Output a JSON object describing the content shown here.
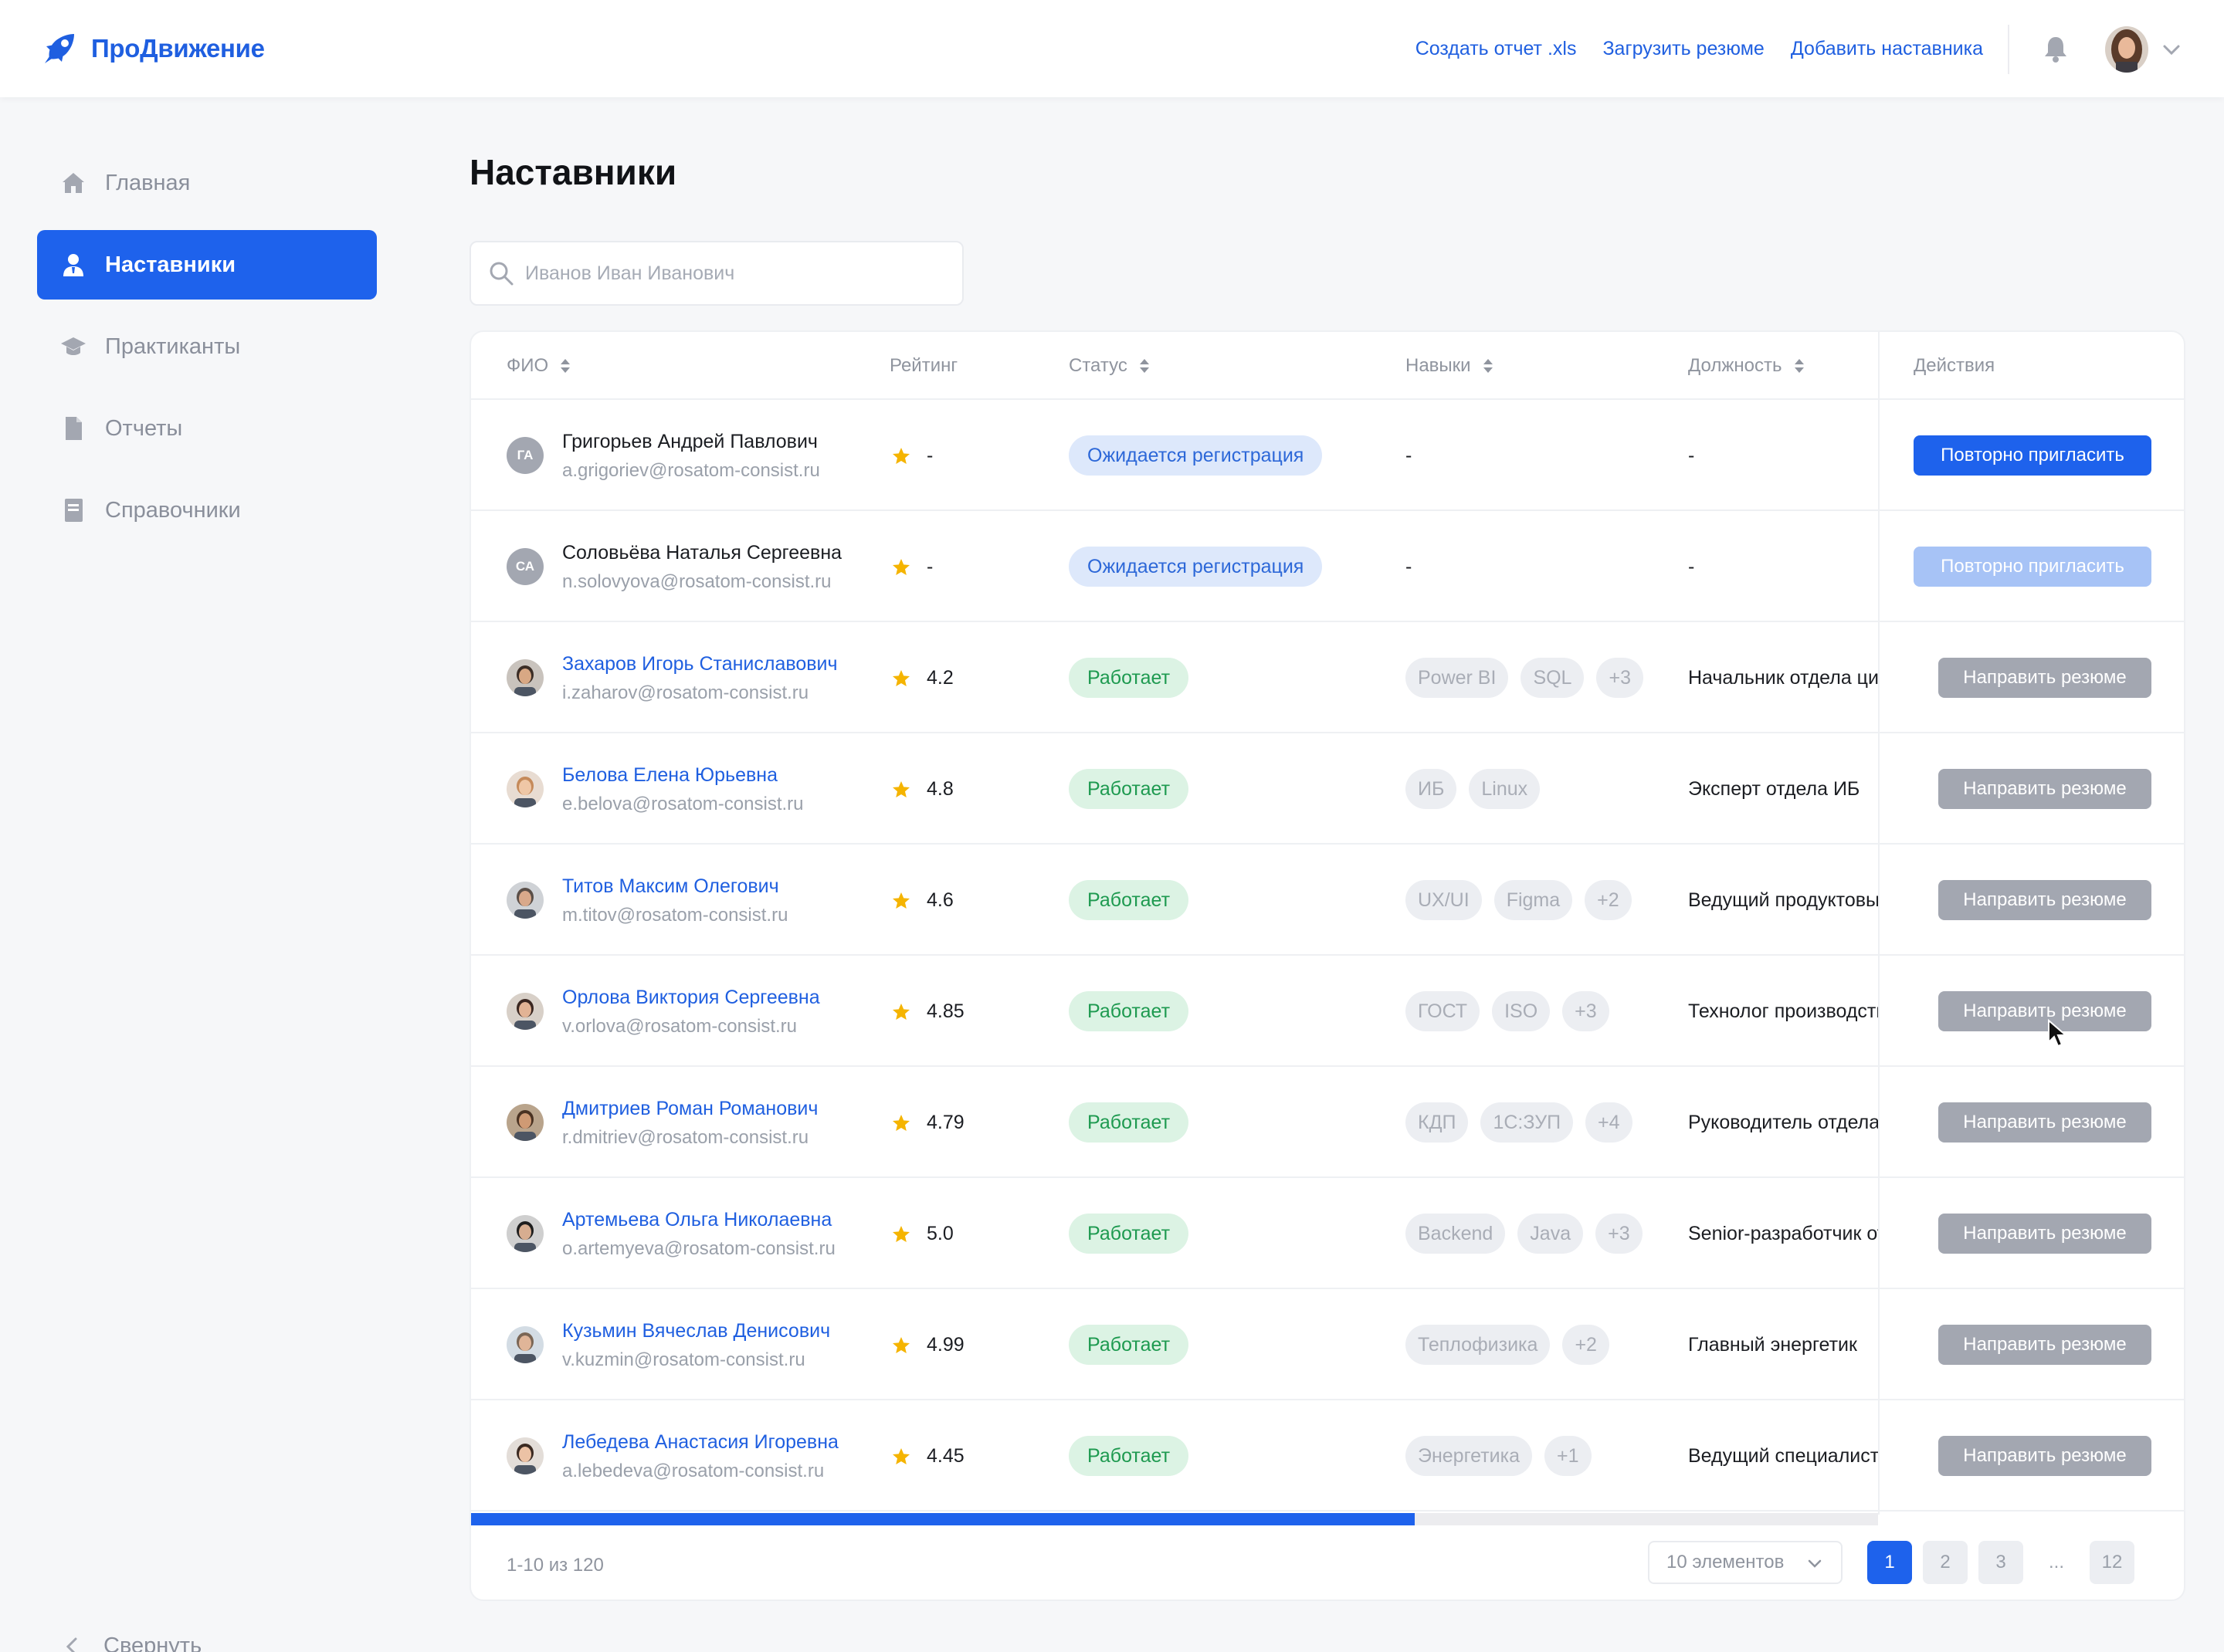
{
  "header": {
    "logo_text": "ПроДвижение",
    "links": [
      "Создать отчет .xls",
      "Загрузить резюме",
      "Добавить наставника"
    ]
  },
  "sidebar": {
    "items": [
      {
        "label": "Главная",
        "icon": "home-icon"
      },
      {
        "label": "Наставники",
        "icon": "mentor-icon",
        "active": true
      },
      {
        "label": "Практиканты",
        "icon": "graduation-cap-icon"
      },
      {
        "label": "Отчеты",
        "icon": "document-icon"
      },
      {
        "label": "Справочники",
        "icon": "book-icon"
      }
    ],
    "collapse_label": "Свернуть"
  },
  "page": {
    "title": "Наставники",
    "search_placeholder": "Иванов Иван Иванович"
  },
  "table": {
    "columns": {
      "fio": "ФИО",
      "rating": "Рейтинг",
      "status": "Статус",
      "skills": "Навыки",
      "position": "Должность",
      "actions": "Действия"
    },
    "rows": [
      {
        "name": "Григорьев Андрей Павлович",
        "email": "a.grigoriev@rosatom-consist.ru",
        "initials": "ГА",
        "rating": "-",
        "status": "Ожидается регистрация",
        "skills": [],
        "skills_dash": "-",
        "position": "-",
        "action": "Повторно пригласить",
        "action_state": "primary"
      },
      {
        "name": "Соловьёва Наталья Сергеевна",
        "email": "n.solovyova@rosatom-consist.ru",
        "initials": "СА",
        "rating": "-",
        "status": "Ожидается регистрация",
        "skills": [],
        "skills_dash": "-",
        "position": "-",
        "action": "Повторно пригласить",
        "action_state": "disabled"
      },
      {
        "name": "Захаров Игорь Станиславович",
        "email": "i.zaharov@rosatom-consist.ru",
        "rating": "4.2",
        "status": "Работает",
        "skills": [
          "Power BI",
          "SQL",
          "+3"
        ],
        "position": "Начальник отдела цифровизации",
        "action": "Направить резюме"
      },
      {
        "name": "Белова Елена Юрьевна",
        "email": "e.belova@rosatom-consist.ru",
        "rating": "4.8",
        "status": "Работает",
        "skills": [
          "ИБ",
          "Linux"
        ],
        "position": "Эксперт отдела ИБ",
        "action": "Направить резюме"
      },
      {
        "name": "Титов Максим Олегович",
        "email": "m.titov@rosatom-consist.ru",
        "rating": "4.6",
        "status": "Работает",
        "skills": [
          "UX/UI",
          "Figma",
          "+2"
        ],
        "position": "Ведущий продуктовый дизайнер",
        "action": "Направить резюме"
      },
      {
        "name": "Орлова Виктория Сергеевна",
        "email": "v.orlova@rosatom-consist.ru",
        "rating": "4.85",
        "status": "Работает",
        "skills": [
          "ГОСТ",
          "ISO",
          "+3"
        ],
        "position": "Технолог производства",
        "action": "Направить резюме"
      },
      {
        "name": "Дмитриев Роман Романович",
        "email": "r.dmitriev@rosatom-consist.ru",
        "rating": "4.79",
        "status": "Работает",
        "skills": [
          "КДП",
          "1С:ЗУП",
          "+4"
        ],
        "position": "Руководитель отдела кадров",
        "action": "Направить резюме"
      },
      {
        "name": "Артемьева Ольга Николаевна",
        "email": "o.artemyeva@rosatom-consist.ru",
        "rating": "5.0",
        "status": "Работает",
        "skills": [
          "Backend",
          "Java",
          "+3"
        ],
        "position": "Senior-разработчик отдела",
        "action": "Направить резюме"
      },
      {
        "name": "Кузьмин Вячеслав Денисович",
        "email": "v.kuzmin@rosatom-consist.ru",
        "rating": "4.99",
        "status": "Работает",
        "skills": [
          "Теплофизика",
          "+2"
        ],
        "position": "Главный энергетик",
        "action": "Направить резюме"
      },
      {
        "name": "Лебедева Анастасия Игоревна",
        "email": "a.lebedeva@rosatom-consist.ru",
        "rating": "4.45",
        "status": "Работает",
        "skills": [
          "Энергетика",
          "+1"
        ],
        "position": "Ведущий специалист",
        "action": "Направить резюме"
      }
    ]
  },
  "pagination": {
    "range_text": "1-10 из 120",
    "page_size": "10 элементов",
    "pages": [
      "1",
      "2",
      "3",
      "...",
      "12"
    ],
    "current": "1"
  },
  "colors": {
    "accent": "#1e62ec",
    "status_working_bg": "#dcf3e4",
    "status_pending_bg": "#dde8fb",
    "star": "#f5b400"
  }
}
